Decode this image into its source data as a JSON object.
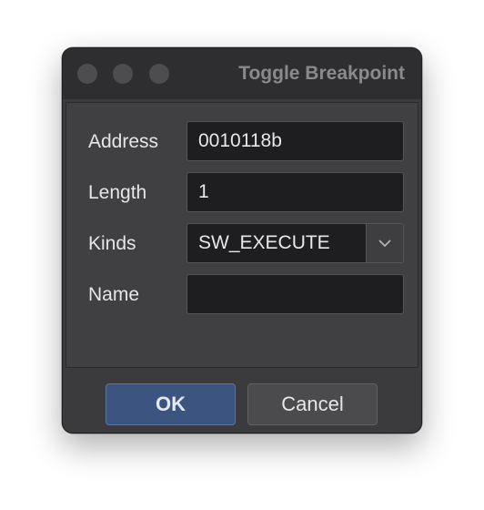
{
  "window": {
    "title": "Toggle Breakpoint"
  },
  "form": {
    "address_label": "Address",
    "address_value": "0010118b",
    "length_label": "Length",
    "length_value": "1",
    "kinds_label": "Kinds",
    "kinds_value": "SW_EXECUTE",
    "name_label": "Name",
    "name_value": ""
  },
  "buttons": {
    "ok_label": "OK",
    "cancel_label": "Cancel"
  },
  "icons": {
    "traffic_lights": [
      "close-icon",
      "minimize-icon",
      "zoom-icon"
    ],
    "dropdown": "chevron-down-icon"
  },
  "colors": {
    "window_bg": "#3b3b3d",
    "field_bg": "#1e1e20",
    "primary_button": "#3c5580",
    "text": "#e6e6e8",
    "title_text": "#8a8a8d"
  }
}
